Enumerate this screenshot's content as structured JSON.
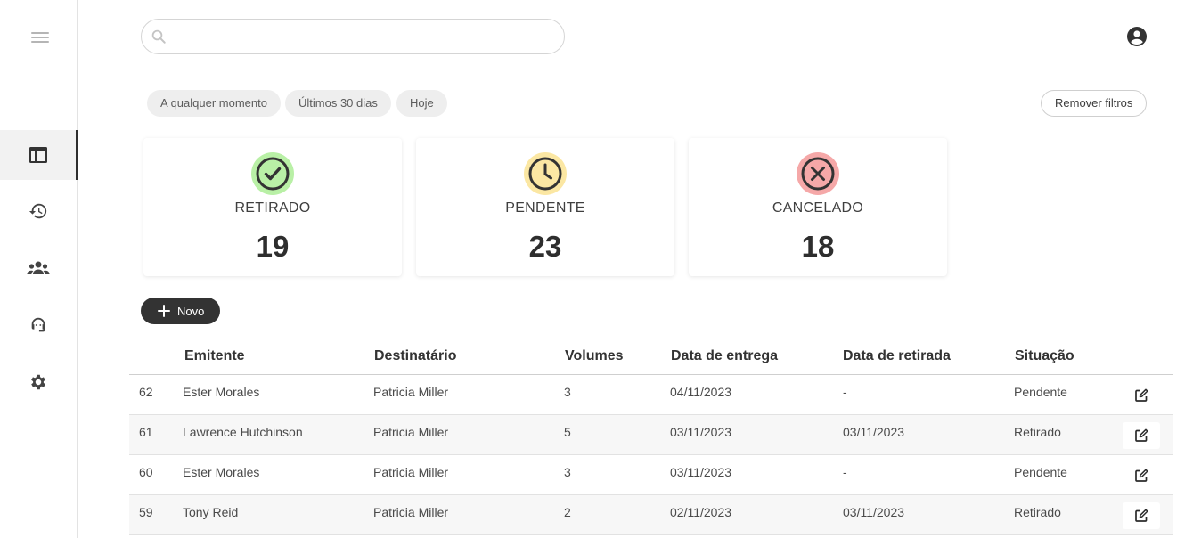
{
  "search": {
    "placeholder": "",
    "value": ""
  },
  "sidebar": {
    "items": [
      {
        "name": "table-view",
        "icon": "table-icon",
        "active": true
      },
      {
        "name": "history",
        "icon": "history-icon",
        "active": false
      },
      {
        "name": "people",
        "icon": "group-icon",
        "active": false
      },
      {
        "name": "support",
        "icon": "support-agent-icon",
        "active": false
      },
      {
        "name": "settings",
        "icon": "gear-icon",
        "active": false
      }
    ]
  },
  "filters": {
    "chips": [
      "A qualquer momento",
      "Últimos 30 dias",
      "Hoje"
    ],
    "clear_label": "Remover filtros"
  },
  "stats": [
    {
      "label": "RETIRADO",
      "value": "19",
      "icon": "check-circle-icon",
      "color": "#b9f0a6"
    },
    {
      "label": "PENDENTE",
      "value": "23",
      "icon": "clock-icon",
      "color": "#fbe7a3"
    },
    {
      "label": "CANCELADO",
      "value": "18",
      "icon": "cancel-circle-icon",
      "color": "#f5a8a8"
    }
  ],
  "new_button_label": "Novo",
  "table": {
    "headers": [
      "Emitente",
      "Destinatário",
      "Volumes",
      "Data de entrega",
      "Data de retirada",
      "Situação"
    ],
    "rows": [
      {
        "id": "62",
        "emitente": "Ester Morales",
        "destinatario": "Patricia Miller",
        "volumes": "3",
        "entrega": "04/11/2023",
        "retirada": "-",
        "situacao": "Pendente"
      },
      {
        "id": "61",
        "emitente": "Lawrence Hutchinson",
        "destinatario": "Patricia Miller",
        "volumes": "5",
        "entrega": "03/11/2023",
        "retirada": "03/11/2023",
        "situacao": "Retirado"
      },
      {
        "id": "60",
        "emitente": "Ester Morales",
        "destinatario": "Patricia Miller",
        "volumes": "3",
        "entrega": "03/11/2023",
        "retirada": "-",
        "situacao": "Pendente"
      },
      {
        "id": "59",
        "emitente": "Tony Reid",
        "destinatario": "Patricia Miller",
        "volumes": "2",
        "entrega": "02/11/2023",
        "retirada": "03/11/2023",
        "situacao": "Retirado"
      }
    ]
  }
}
